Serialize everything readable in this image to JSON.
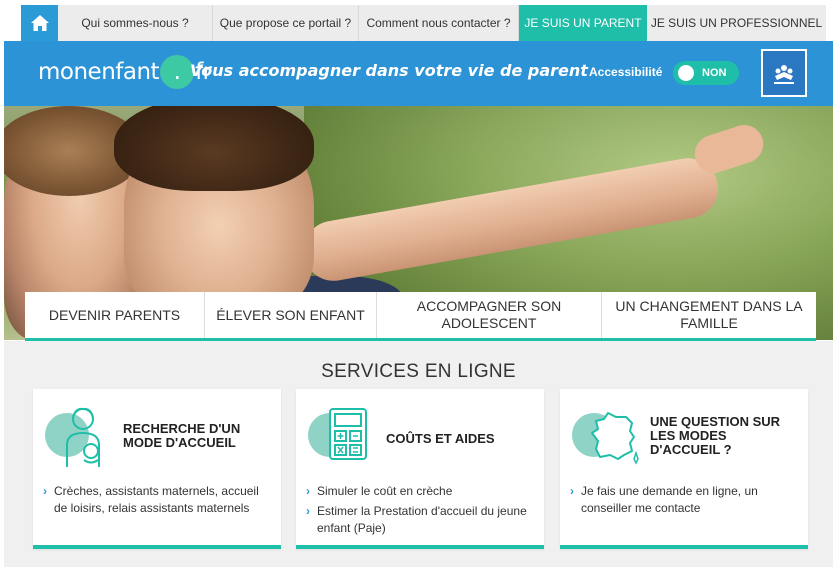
{
  "topbar": {
    "home_icon": "home-icon",
    "items": [
      {
        "label": "Qui sommes-nous ?"
      },
      {
        "label": "Que propose ce portail ?"
      },
      {
        "label": "Comment nous contacter ?"
      },
      {
        "label": "JE SUIS UN PARENT"
      },
      {
        "label": "JE SUIS UN PROFESSIONNEL"
      }
    ],
    "active_color": "#1fbea8"
  },
  "header": {
    "logo_part1": "monenfant",
    "logo_dot": ".",
    "logo_part2": "fr",
    "tagline": "Vous accompagner dans votre vie de parent",
    "accessibility_label": "Accessibilité",
    "accessibility_toggle": "NON",
    "bg_color": "#2b93d6"
  },
  "categories": [
    {
      "label": "DEVENIR PARENTS"
    },
    {
      "label": "ÉLEVER SON ENFANT"
    },
    {
      "label": "ACCOMPAGNER SON ADOLESCENT"
    },
    {
      "label": "UN CHANGEMENT DANS LA FAMILLE"
    }
  ],
  "services": {
    "title": "SERVICES EN LIGNE",
    "cards": [
      {
        "title": "RECHERCHE D'UN MODE D'ACCUEIL",
        "icon": "childminder-icon",
        "links": [
          "Crèches, assistants maternels, accueil de loisirs, relais assistants maternels"
        ]
      },
      {
        "title": "COÛTS ET AIDES",
        "icon": "calculator-icon",
        "links": [
          "Simuler le coût en crèche",
          "Estimer la Prestation d'accueil du jeune enfant (Paje)"
        ]
      },
      {
        "title": "UNE QUESTION SUR LES MODES D'ACCUEIL ?",
        "icon": "france-map-icon",
        "links": [
          "Je fais une demande en ligne, un conseiller me contacte"
        ]
      }
    ]
  }
}
